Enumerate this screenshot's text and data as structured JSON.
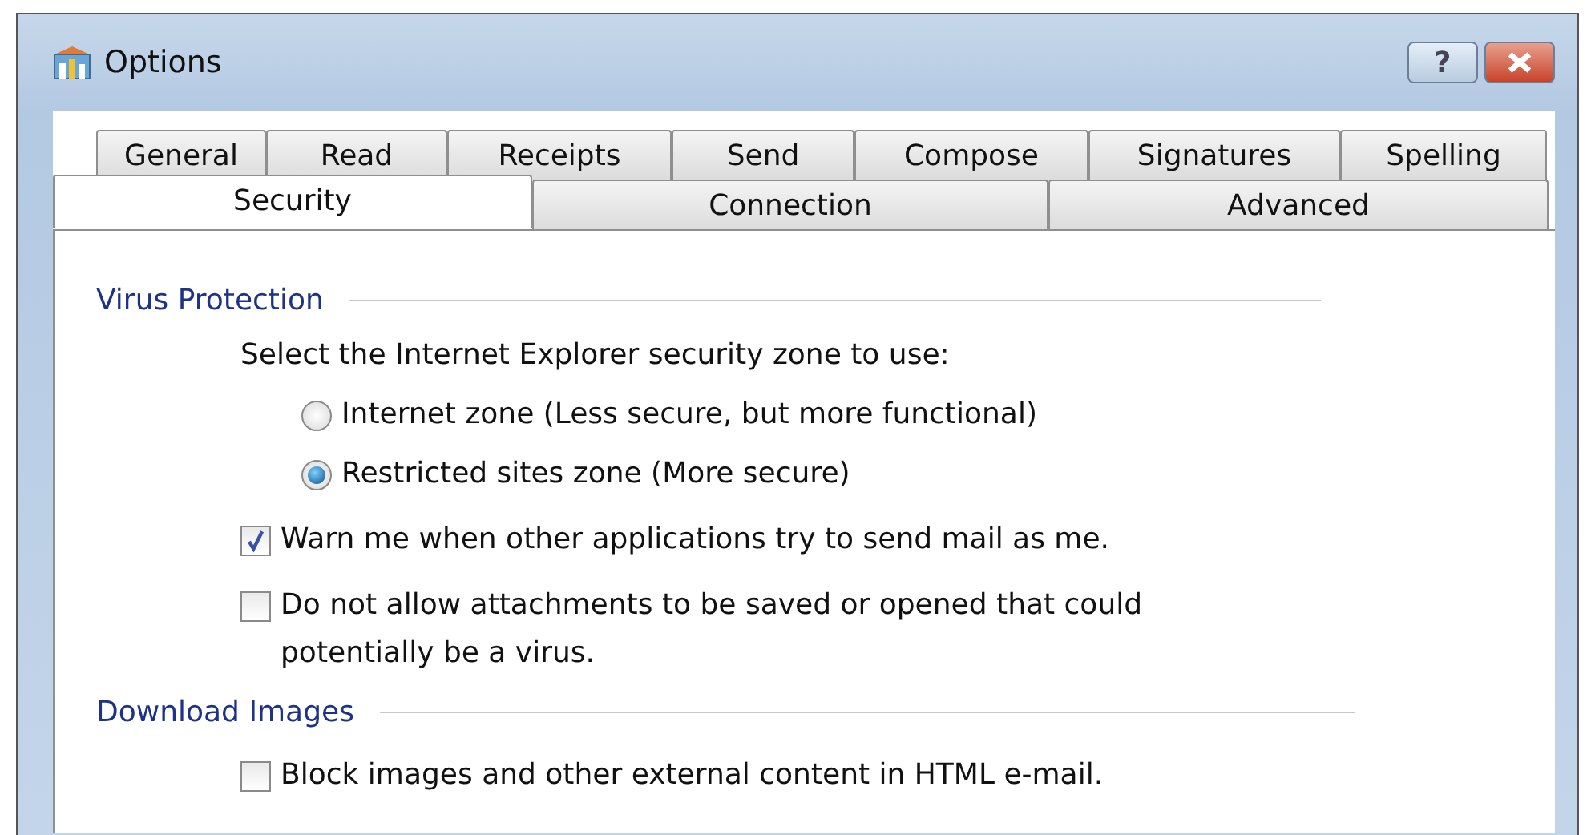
{
  "window": {
    "title": "Options",
    "help_button": "?"
  },
  "tab_rows": [
    [
      {
        "label": "General",
        "selected": false
      },
      {
        "label": "Read",
        "selected": false
      },
      {
        "label": "Receipts",
        "selected": false
      },
      {
        "label": "Send",
        "selected": false
      },
      {
        "label": "Compose",
        "selected": false
      },
      {
        "label": "Signatures",
        "selected": false
      },
      {
        "label": "Spelling",
        "selected": false
      }
    ],
    [
      {
        "label": "Security",
        "selected": true
      },
      {
        "label": "Connection",
        "selected": false
      },
      {
        "label": "Advanced",
        "selected": false
      }
    ]
  ],
  "sections": [
    {
      "title": "Virus Protection",
      "items": [
        {
          "kind": "text",
          "text": "Select the Internet Explorer security zone to use:"
        },
        {
          "kind": "radio",
          "label": "Internet zone (Less secure, but more functional)",
          "selected": false
        },
        {
          "kind": "radio",
          "label": "Restricted sites zone (More secure)",
          "selected": true
        },
        {
          "kind": "checkbox",
          "label": "Warn me when other applications try to send mail as me.",
          "checked": true
        },
        {
          "kind": "checkbox",
          "label": "Do not allow attachments to be saved or opened that could potentially be a virus.",
          "checked": false
        }
      ]
    },
    {
      "title": "Download Images",
      "items": [
        {
          "kind": "checkbox",
          "label": "Block images and other external content in HTML e-mail.",
          "checked": false
        }
      ]
    }
  ]
}
